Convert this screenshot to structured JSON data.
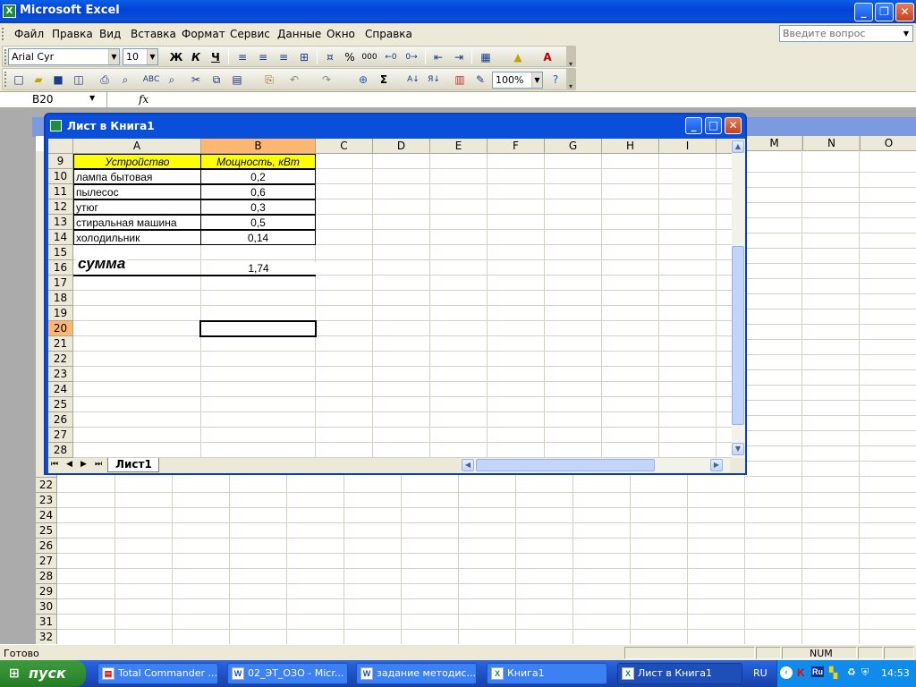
{
  "window": {
    "title": "Microsoft Excel"
  },
  "menu": [
    "Файл",
    "Правка",
    "Вид",
    "Вставка",
    "Формат",
    "Сервис",
    "Данные",
    "Окно",
    "Справка"
  ],
  "ask_placeholder": "Введите вопрос",
  "formatting": {
    "font": "Arial Cyr",
    "size": "10",
    "bold": "Ж",
    "italic": "К",
    "underline": "Ч",
    "percent": "%",
    "thousands": "000"
  },
  "standard": {
    "zoom": "100%",
    "sum": "Σ"
  },
  "formula_bar": {
    "name_box": "B20",
    "fx": "fx",
    "value": ""
  },
  "child": {
    "title": "Лист в Книга1",
    "sheet_tab": "Лист1"
  },
  "columns": [
    "A",
    "B",
    "C",
    "D",
    "E",
    "F",
    "G",
    "H",
    "I"
  ],
  "bg_columns": [
    "M",
    "N",
    "O"
  ],
  "rows": [
    "9",
    "10",
    "11",
    "12",
    "13",
    "14",
    "15",
    "16",
    "17",
    "18",
    "19",
    "20",
    "21",
    "22",
    "23",
    "24",
    "25",
    "26",
    "27",
    "28"
  ],
  "bg_rows": [
    "22",
    "23",
    "24",
    "25",
    "26",
    "27",
    "28",
    "29",
    "30",
    "31",
    "32"
  ],
  "table": {
    "header": {
      "device": "Устройство",
      "power": "Мощность, кВт"
    },
    "items": [
      {
        "device": "лампа бытовая",
        "power": "0,2"
      },
      {
        "device": "пылесос",
        "power": "0,6"
      },
      {
        "device": "утюг",
        "power": "0,3"
      },
      {
        "device": "стиральная машина",
        "power": "0,5"
      },
      {
        "device": "холодильник",
        "power": "0,14"
      }
    ],
    "sum_label": "сумма",
    "sum_value": "1,74"
  },
  "status": {
    "text": "Готово",
    "num": "NUM"
  },
  "taskbar": {
    "start": "пуск",
    "tasks": [
      "Total Commander ...",
      "02_ЭТ_ОЗО - Micr...",
      "задание методис...",
      "Книга1",
      "Лист в Книга1"
    ],
    "lang": "RU",
    "clock": "14:53"
  }
}
